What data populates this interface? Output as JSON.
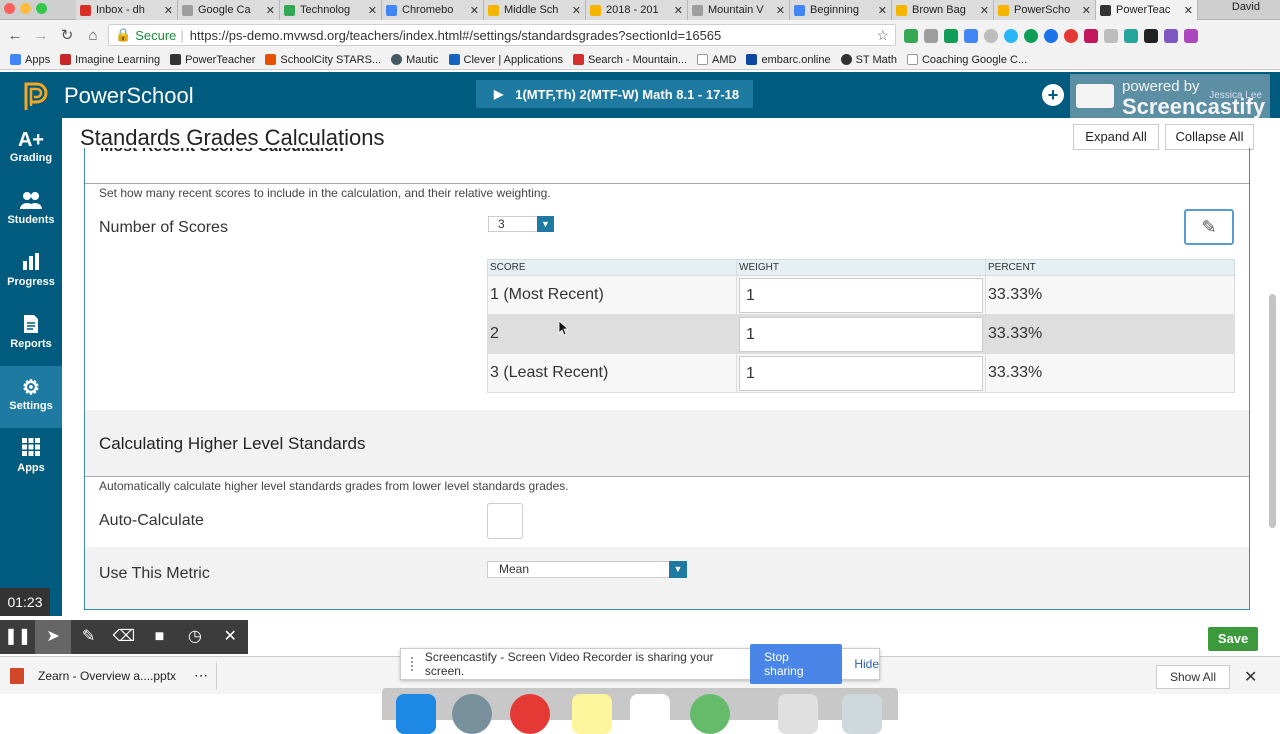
{
  "browser": {
    "tabs": [
      {
        "title": "Inbox - dh",
        "color": "#d93025"
      },
      {
        "title": "Google Ca",
        "color": "#9e9e9e"
      },
      {
        "title": "Technolog",
        "color": "#34a853"
      },
      {
        "title": "Chromebo",
        "color": "#4285f4"
      },
      {
        "title": "Middle Sch",
        "color": "#f4b400"
      },
      {
        "title": "2018 - 201",
        "color": "#f4b400"
      },
      {
        "title": "Mountain V",
        "color": "#9e9e9e"
      },
      {
        "title": "Beginning",
        "color": "#4285f4"
      },
      {
        "title": "Brown Bag",
        "color": "#f4b400"
      },
      {
        "title": "PowerScho",
        "color": "#f4b400"
      },
      {
        "title": "PowerTeac",
        "color": "#333333"
      }
    ],
    "profile": "David",
    "secure_label": "Secure",
    "url": "https://ps-demo.mvwsd.org/teachers/index.html#/settings/standardsgrades?sectionId=16565",
    "bookmarks": [
      {
        "label": "Apps",
        "color": "#4285f4"
      },
      {
        "label": "Imagine Learning",
        "color": "#c62828"
      },
      {
        "label": "PowerTeacher",
        "color": "#333333"
      },
      {
        "label": "SchoolCity STARS...",
        "color": "#e65100"
      },
      {
        "label": "Mautic",
        "color": "#455a64"
      },
      {
        "label": "Clever | Applications",
        "color": "#1565c0"
      },
      {
        "label": "Search - Mountain...",
        "color": "#d32f2f"
      },
      {
        "label": "AMD",
        "color": "#9e9e9e"
      },
      {
        "label": "embarc.online",
        "color": "#0d47a1"
      },
      {
        "label": "ST Math",
        "color": "#333333"
      },
      {
        "label": "Coaching Google C...",
        "color": "#9e9e9e"
      }
    ]
  },
  "app": {
    "name": "PowerSchool",
    "class_selector": "1(MTF,Th) 2(MTF-W) Math 8.1  -  17-18",
    "overlay": {
      "powered_by": "powered by",
      "brand": "Screencastify",
      "user": "Jessica Lee"
    },
    "sidebar": [
      {
        "label": "Grading",
        "icon": "A+"
      },
      {
        "label": "Students",
        "icon": "people-icon"
      },
      {
        "label": "Progress",
        "icon": "bar-chart-icon"
      },
      {
        "label": "Reports",
        "icon": "document-icon"
      },
      {
        "label": "Settings",
        "icon": "gear-icon"
      },
      {
        "label": "Apps",
        "icon": "grid-icon"
      }
    ],
    "colors": {
      "header": "#005b7f",
      "accent": "#1e7aa1",
      "save": "#3c9a3c"
    }
  },
  "page": {
    "title": "Standards Grades Calculations",
    "expand_all": "Expand All",
    "collapse_all": "Collapse All",
    "recent": {
      "heading": "Most Recent Scores Calculation",
      "description": "Set how many recent scores to include in the calculation, and their relative weighting.",
      "number_label": "Number of Scores",
      "number_value": "3",
      "columns": [
        "SCORE",
        "WEIGHT",
        "PERCENT"
      ],
      "rows": [
        {
          "score": "1 (Most Recent)",
          "weight": "1",
          "percent": "33.33%"
        },
        {
          "score": "2",
          "weight": "1",
          "percent": "33.33%"
        },
        {
          "score": "3 (Least Recent)",
          "weight": "1",
          "percent": "33.33%"
        }
      ]
    },
    "higher": {
      "heading": "Calculating Higher Level Standards",
      "description": "Automatically calculate higher level standards grades from lower level standards grades.",
      "auto_label": "Auto-Calculate",
      "metric_label": "Use This Metric",
      "metric_value": "Mean"
    },
    "save": "Save"
  },
  "recorder": {
    "time": "01:23"
  },
  "share": {
    "message": "Screencastify - Screen Video Recorder is sharing your screen.",
    "stop": "Stop sharing",
    "hide": "Hide"
  },
  "downloads": {
    "file": "Zearn - Overview a....pptx",
    "show_all": "Show All"
  }
}
